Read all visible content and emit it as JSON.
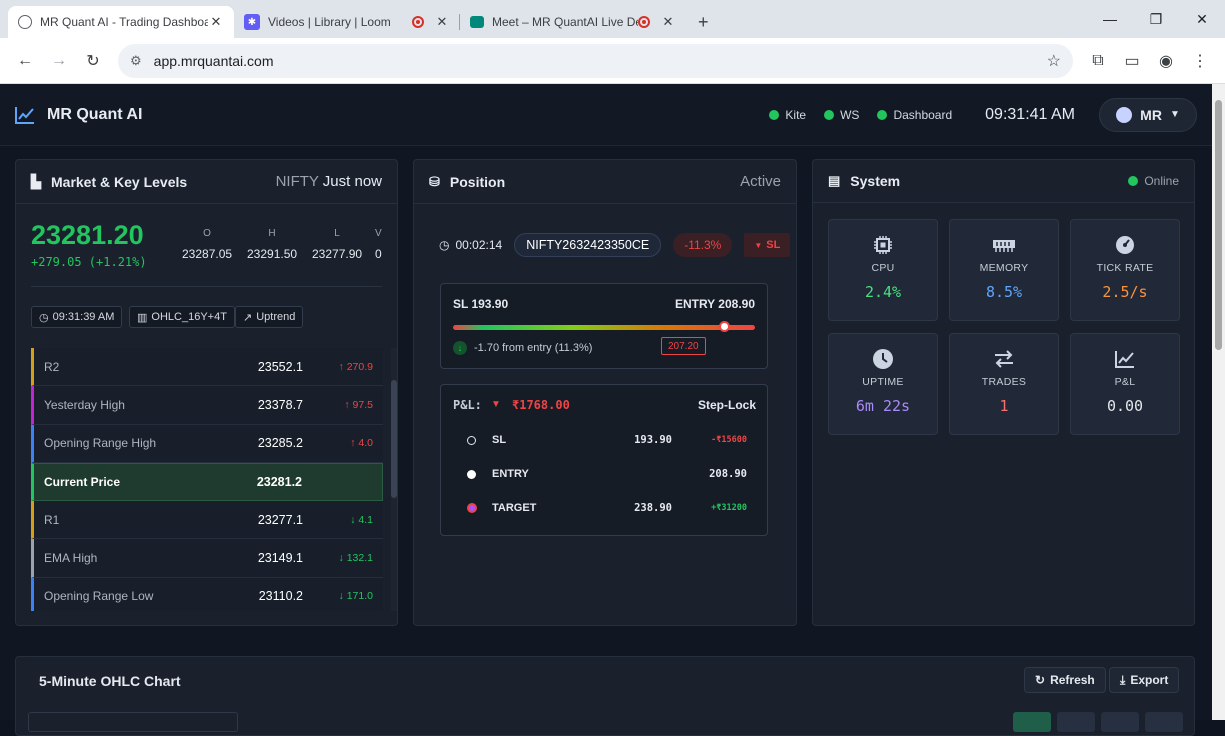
{
  "browser": {
    "tabs": [
      {
        "title": "MR Quant AI - Trading Dashboard",
        "active": true
      },
      {
        "title": "Videos | Library | Loom",
        "active": false
      },
      {
        "title": "Meet – MR QuantAI Live De",
        "active": false
      }
    ],
    "url": "app.mrquantai.com"
  },
  "header": {
    "title": "MR Quant AI",
    "status": [
      "Kite",
      "WS",
      "Dashboard"
    ],
    "time": "09:31:41 AM",
    "user": "MR"
  },
  "market": {
    "title": "Market & Key Levels",
    "symbol": "NIFTY",
    "updated": "Just now",
    "price": "23281.20",
    "change": "+279.05 (+1.21%)",
    "ohlc": [
      {
        "label": "O",
        "value": "23287.05"
      },
      {
        "label": "H",
        "value": "23291.50"
      },
      {
        "label": "L",
        "value": "23277.90"
      },
      {
        "label": "V",
        "value": "0"
      }
    ],
    "chips": {
      "time": "09:31:39 AM",
      "candles": "OHLC_16Y+4T",
      "trend": "Uptrend"
    },
    "levels": [
      {
        "name": "R2",
        "value": "23552.1",
        "delta": "↑ 270.9",
        "dir": "up",
        "color": "#d4a017"
      },
      {
        "name": "Yesterday High",
        "value": "23378.7",
        "delta": "↑ 97.5",
        "dir": "up",
        "color": "#c026d3"
      },
      {
        "name": "Opening Range High",
        "value": "23285.2",
        "delta": "↑ 4.0",
        "dir": "up",
        "color": "#3b82f6"
      },
      {
        "name": "Current Price",
        "value": "23281.2",
        "delta": "",
        "dir": "cur",
        "color": "#22c55e"
      },
      {
        "name": "R1",
        "value": "23277.1",
        "delta": "↓ 4.1",
        "dir": "down",
        "color": "#d4a017"
      },
      {
        "name": "EMA High",
        "value": "23149.1",
        "delta": "↓ 132.1",
        "dir": "down",
        "color": "#9ca3af"
      },
      {
        "name": "Opening Range Low",
        "value": "23110.2",
        "delta": "↓ 171.0",
        "dir": "down",
        "color": "#3b82f6"
      }
    ]
  },
  "position": {
    "title": "Position",
    "state": "Active",
    "duration": "00:02:14",
    "symbol": "NIFTY2632423350CE",
    "pnl_pct": "-11.3%",
    "sl_badge": "SL",
    "sl_label": "SL 193.90",
    "entry_label": "ENTRY 208.90",
    "marker_price": "207.20",
    "marker_fraction": 0.89,
    "from_entry": "-1.70 from entry (11.3%)",
    "pnl_label": "P&L:",
    "pnl_value": "₹1768.00",
    "mode": "Step-Lock",
    "rows": [
      {
        "name": "SL",
        "price": "193.90",
        "amount": "-₹15600",
        "color": "#ef4444"
      },
      {
        "name": "ENTRY",
        "price": "208.90",
        "amount": "",
        "color": "#22c55e"
      },
      {
        "name": "TARGET",
        "price": "238.90",
        "amount": "+₹31200",
        "color": "#22c55e"
      }
    ]
  },
  "system": {
    "title": "System",
    "state": "Online",
    "cards": [
      {
        "label": "CPU",
        "value": "2.4%",
        "color": "#4ade80",
        "icon": "cpu-icon"
      },
      {
        "label": "MEMORY",
        "value": "8.5%",
        "color": "#60a5fa",
        "icon": "memory-icon"
      },
      {
        "label": "TICK RATE",
        "value": "2.5/s",
        "color": "#fb923c",
        "icon": "gauge-icon"
      },
      {
        "label": "UPTIME",
        "value": "6m 22s",
        "color": "#a78bfa",
        "icon": "clock-icon"
      },
      {
        "label": "TRADES",
        "value": "1",
        "color": "#f87171",
        "icon": "swap-icon"
      },
      {
        "label": "P&L",
        "value": "0.00",
        "color": "#e5e7eb",
        "icon": "chart-icon"
      }
    ]
  },
  "chart": {
    "title": "5-Minute OHLC Chart",
    "refresh": "Refresh",
    "export": "Export"
  }
}
